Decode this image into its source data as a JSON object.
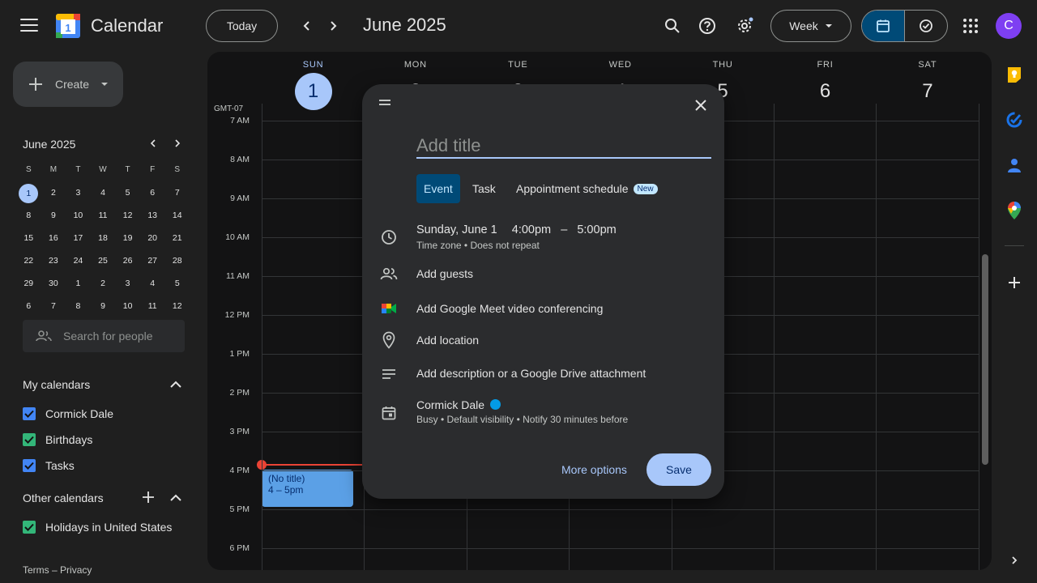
{
  "app": {
    "name": "Calendar",
    "logo_day": "1"
  },
  "header": {
    "today_label": "Today",
    "title": "June 2025",
    "view_selector": "Week",
    "avatar_letter": "C"
  },
  "sidebar": {
    "create_label": "Create",
    "mini_calendar": {
      "title": "June 2025",
      "weekday_heads": [
        "S",
        "M",
        "T",
        "W",
        "T",
        "F",
        "S"
      ],
      "weeks": [
        [
          "1",
          "2",
          "3",
          "4",
          "5",
          "6",
          "7"
        ],
        [
          "8",
          "9",
          "10",
          "11",
          "12",
          "13",
          "14"
        ],
        [
          "15",
          "16",
          "17",
          "18",
          "19",
          "20",
          "21"
        ],
        [
          "22",
          "23",
          "24",
          "25",
          "26",
          "27",
          "28"
        ],
        [
          "29",
          "30",
          "1",
          "2",
          "3",
          "4",
          "5"
        ],
        [
          "6",
          "7",
          "8",
          "9",
          "10",
          "11",
          "12"
        ]
      ],
      "selected": "1"
    },
    "search_people_placeholder": "Search for people",
    "my_calendars_title": "My calendars",
    "my_calendars": [
      {
        "name": "Cormick Dale",
        "color": "#4285f4"
      },
      {
        "name": "Birthdays",
        "color": "#33b679"
      },
      {
        "name": "Tasks",
        "color": "#4285f4"
      }
    ],
    "other_calendars_title": "Other calendars",
    "other_calendars": [
      {
        "name": "Holidays in United States",
        "color": "#33b679"
      }
    ],
    "footer": {
      "terms": "Terms",
      "separator": "–",
      "privacy": "Privacy"
    }
  },
  "week": {
    "timezone": "GMT-07",
    "days": [
      {
        "name": "SUN",
        "num": "1",
        "today": true
      },
      {
        "name": "MON",
        "num": "2"
      },
      {
        "name": "TUE",
        "num": "3"
      },
      {
        "name": "WED",
        "num": "4"
      },
      {
        "name": "THU",
        "num": "5"
      },
      {
        "name": "FRI",
        "num": "6"
      },
      {
        "name": "SAT",
        "num": "7"
      }
    ],
    "hours": [
      "7 AM",
      "8 AM",
      "9 AM",
      "10 AM",
      "11 AM",
      "12 PM",
      "1 PM",
      "2 PM",
      "3 PM",
      "4 PM",
      "5 PM",
      "6 PM"
    ],
    "event": {
      "title": "(No title)",
      "time": "4 – 5pm"
    }
  },
  "dialog": {
    "title_placeholder": "Add title",
    "tabs": {
      "event": "Event",
      "task": "Task",
      "appointment": "Appointment schedule",
      "new_badge": "New"
    },
    "date": "Sunday, June 1",
    "start": "4:00pm",
    "dash": "–",
    "end": "5:00pm",
    "timezone_link": "Time zone",
    "bullet": "•",
    "repeat": "Does not repeat",
    "add_guests": "Add guests",
    "add_meet": "Add Google Meet video conferencing",
    "add_location": "Add location",
    "add_description": "Add description or a Google Drive attachment",
    "calendar_name": "Cormick Dale",
    "calendar_details": "Busy • Default visibility • Notify 30 minutes before",
    "more_options": "More options",
    "save": "Save"
  },
  "colors": {
    "accent": "#a8c7fa",
    "today_circle": "#a8c7fa",
    "event": "#5ba0e6",
    "now_line": "#ea4335",
    "calendar_dot": "#039be5"
  }
}
